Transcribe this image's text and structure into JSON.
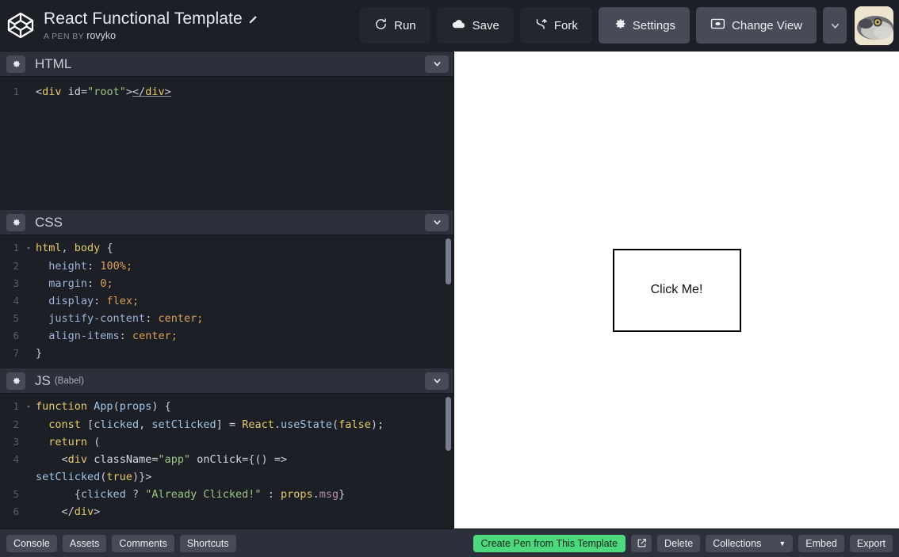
{
  "header": {
    "logo_icon": "codepen-logo-icon",
    "pen_title": "React Functional Template",
    "edit_icon": "pencil-edit-icon",
    "byline_label": "A PEN BY",
    "byline_author": "rovyko",
    "buttons": [
      {
        "label": "Run",
        "icon": "refresh-run-icon",
        "style": "dark"
      },
      {
        "label": "Save",
        "icon": "cloud-save-icon",
        "style": "dark"
      },
      {
        "label": "Fork",
        "icon": "fork-icon",
        "style": "dark"
      },
      {
        "label": "Settings",
        "icon": "gear-icon",
        "style": "gray"
      },
      {
        "label": "Change View",
        "icon": "screen-view-icon",
        "style": "gray"
      }
    ],
    "caret_icon": "chevron-down-icon",
    "avatar_icon": "user-avatar-pufferfish"
  },
  "editors": [
    {
      "title": "HTML",
      "subtitle": "",
      "gear_icon": "gear-icon",
      "caret_icon": "chevron-down-icon",
      "lines": [
        {
          "n": "1",
          "fold": ""
        }
      ]
    },
    {
      "title": "CSS",
      "subtitle": "",
      "gear_icon": "gear-icon",
      "caret_icon": "chevron-down-icon",
      "lines": [
        {
          "n": "1",
          "fold": "▾"
        },
        {
          "n": "2",
          "fold": ""
        },
        {
          "n": "3",
          "fold": ""
        },
        {
          "n": "4",
          "fold": ""
        },
        {
          "n": "5",
          "fold": ""
        },
        {
          "n": "6",
          "fold": ""
        },
        {
          "n": "7",
          "fold": ""
        }
      ]
    },
    {
      "title": "JS",
      "subtitle": "(Babel)",
      "gear_icon": "gear-icon",
      "caret_icon": "chevron-down-icon",
      "lines": [
        {
          "n": "1",
          "fold": "▾"
        },
        {
          "n": "2",
          "fold": ""
        },
        {
          "n": "3",
          "fold": ""
        },
        {
          "n": "4",
          "fold": ""
        },
        {
          "n": "5",
          "fold": ""
        },
        {
          "n": "6",
          "fold": ""
        }
      ]
    }
  ],
  "code": {
    "html": {
      "line1": "<div id=\"root\"></div>"
    },
    "css": {
      "line1": "html, body {",
      "line2": "  height: 100%;",
      "line3": "  margin: 0;",
      "line4": "  display: flex;",
      "line5": "  justify-content: center;",
      "line6": "  align-items: center;",
      "line7": "}"
    },
    "js": {
      "line1": "function App(props) {",
      "line2": "  const [clicked, setClicked] = React.useState(false);",
      "line3": "  return (",
      "line4": "    <div className=\"app\" onClick={() =>",
      "line4_cont": "setClicked(true)}>",
      "line5": "      {clicked ? \"Already Clicked!\" : props.msg}",
      "line6": "    </div>"
    }
  },
  "preview": {
    "box_text": "Click Me!"
  },
  "footer": {
    "left_buttons": [
      {
        "label": "Console"
      },
      {
        "label": "Assets"
      },
      {
        "label": "Comments"
      },
      {
        "label": "Shortcuts"
      }
    ],
    "create_pen_label": "Create Pen from This Template",
    "external_icon": "external-link-icon",
    "delete_label": "Delete",
    "collections_label": "Collections",
    "collections_caret": "▼",
    "embed_label": "Embed",
    "export_label": "Export"
  },
  "colors": {
    "accent_green": "#4ed97f",
    "header_bg": "#1d1f26",
    "panel_head_bg": "#2c303a",
    "editor_bg": "#1d1f26",
    "button_gray": "#474b57"
  }
}
